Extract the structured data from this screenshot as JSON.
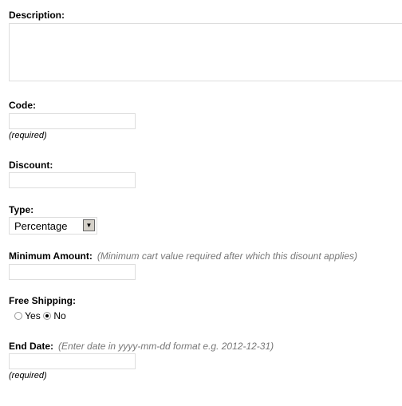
{
  "form": {
    "description": {
      "label": "Description:",
      "value": ""
    },
    "code": {
      "label": "Code:",
      "value": "",
      "note": "(required)"
    },
    "discount": {
      "label": "Discount:",
      "value": ""
    },
    "type": {
      "label": "Type:",
      "selected": "Percentage"
    },
    "minimum_amount": {
      "label": "Minimum Amount:",
      "hint": "(Minimum cart value required after which this disount applies)",
      "value": ""
    },
    "free_shipping": {
      "label": "Free Shipping:",
      "options": [
        "Yes",
        "No"
      ],
      "selected": "No"
    },
    "end_date": {
      "label": "End Date:",
      "hint": "(Enter date in yyyy-mm-dd format e.g. 2012-12-31)",
      "value": "",
      "note": "(required)"
    }
  }
}
